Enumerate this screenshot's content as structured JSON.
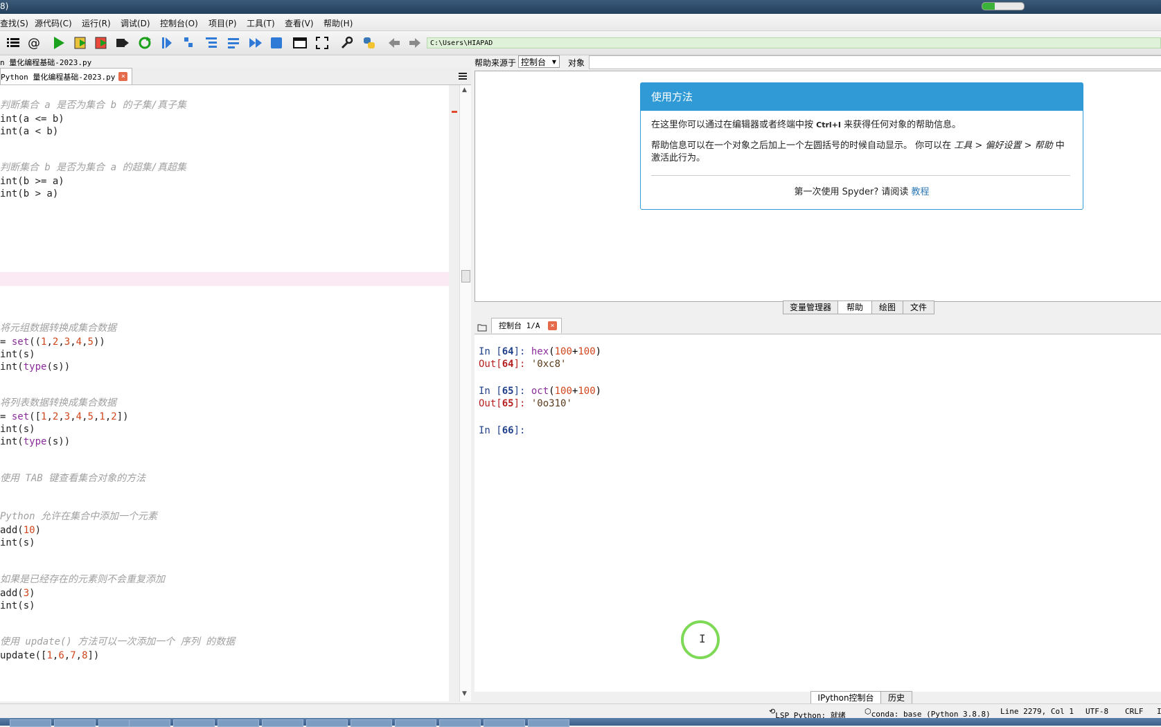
{
  "titlebar": {
    "title": "8)",
    "progress": 0.3
  },
  "menu": [
    "查找(S)",
    "源代码(C)",
    "运行(R)",
    "调试(D)",
    "控制台(O)",
    "项目(P)",
    "工具(T)",
    "查看(V)",
    "帮助(H)"
  ],
  "toolbar": {
    "path": "C:\\Users\\HIAPAD",
    "icons": [
      "outline-icon",
      "at-icon",
      "run-icon",
      "run-cell-icon",
      "run-cell-advance-icon",
      "run-selection-icon",
      "rerun-icon",
      "debug-icon",
      "step-icon",
      "step-into-icon",
      "step-return-icon",
      "continue-icon",
      "stop-icon",
      "maximize-pane-icon",
      "fullscreen-icon",
      "preferences-icon",
      "python-path-icon",
      "back-icon",
      "forward-icon"
    ]
  },
  "editor": {
    "path_label": "n 量化编程基础-2023.py",
    "tab_label": "Python 量化编程基础-2023.py",
    "tab_close": "×"
  },
  "help": {
    "source_label": "帮助来源于",
    "source_value": "控制台",
    "object_label": "对象",
    "card_title": "使用方法",
    "p1_pre": "在这里你可以通过在编辑器或者终端中按 ",
    "p1_key": "Ctrl+I",
    "p1_post": " 来获得任何对象的帮助信息。",
    "p2_pre": "帮助信息可以在一个对象之后加上一个左圆括号的时候自动显示。 你可以在 ",
    "p2_em": "工具 > 偏好设置 > 帮助",
    "p2_post": " 中激活此行为。",
    "foot_pre": "第一次使用 Spyder? 请阅读 ",
    "foot_link": "教程",
    "pane_tabs": [
      "变量管理器",
      "帮助",
      "绘图",
      "文件"
    ]
  },
  "console": {
    "tab_label": "控制台 1/A",
    "tab_close": "×",
    "bottom_tabs": [
      "IPython控制台",
      "历史"
    ]
  },
  "status": {
    "lsp": "LSP Python: 就绪",
    "conda": "conda: base (Python 3.8.8)",
    "position": "Line 2279, Col 1",
    "encoding": "UTF-8",
    "eol": "CRLF",
    "extra": "I"
  }
}
